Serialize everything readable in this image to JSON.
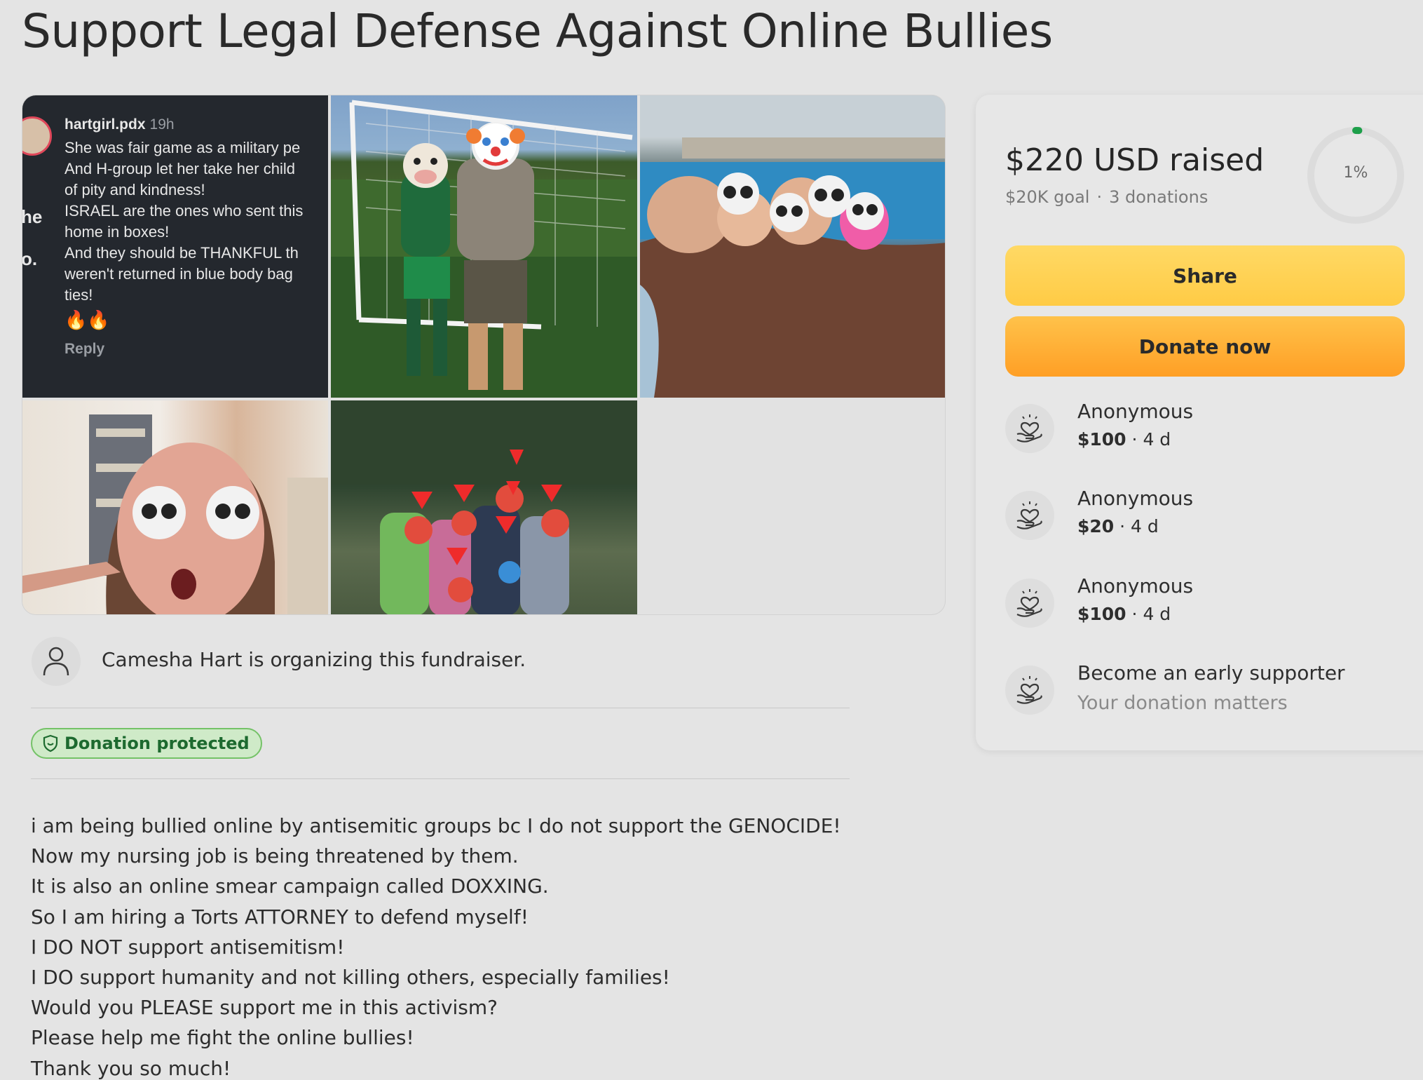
{
  "title": "Support Legal Defense Against Online Bullies",
  "comment": {
    "username": "hartgirl.pdx",
    "time": "19h",
    "body": "She was fair game as a military pe\nAnd H-group let her take her child\nof pity and kindness!\nISRAEL are the ones who sent this\nhome in boxes!\nAnd they should be THANKFUL th\nweren't returned in blue body bag\nties!",
    "edge_text_1": "he",
    "edge_text_2": "o.",
    "reactions": "🔥🔥",
    "reply_label": "Reply"
  },
  "organizer_text": "Camesha Hart is organizing this fundraiser.",
  "badge_label": "Donation protected",
  "story_lines": [
    "i am being bullied online by antisemitic groups bc I do not support the GENOCIDE!",
    "Now my nursing job is being threatened by them.",
    "It is also an online smear campaign called DOXXING.",
    "So I am hiring a Torts ATTORNEY to defend myself!",
    "I DO NOT support antisemitism!",
    "I DO support humanity and not killing others, especially families!",
    "Would you PLEASE support me in this activism?",
    "Please help me fight the online bullies!",
    "Thank you so much!"
  ],
  "sidebar": {
    "raised": "$220 USD raised",
    "goal": "$20K goal",
    "donations_count": "3 donations",
    "progress_label": "1%",
    "progress_fraction": 0.011,
    "share_label": "Share",
    "donate_label": "Donate now",
    "donors": [
      {
        "name": "Anonymous",
        "amount": "$100",
        "age": "4 d"
      },
      {
        "name": "Anonymous",
        "amount": "$20",
        "age": "4 d"
      },
      {
        "name": "Anonymous",
        "amount": "$100",
        "age": "4 d"
      }
    ],
    "early": {
      "title": "Become an early supporter",
      "subtitle": "Your donation matters"
    }
  },
  "colors": {
    "accent_green": "#1d9f4a",
    "badge_bg": "#cfeac8",
    "share_yellow": "#ffcb45",
    "donate_orange": "#ffa52c"
  },
  "icons": [
    "person-icon",
    "shield-icon",
    "heart-hand-icon"
  ]
}
